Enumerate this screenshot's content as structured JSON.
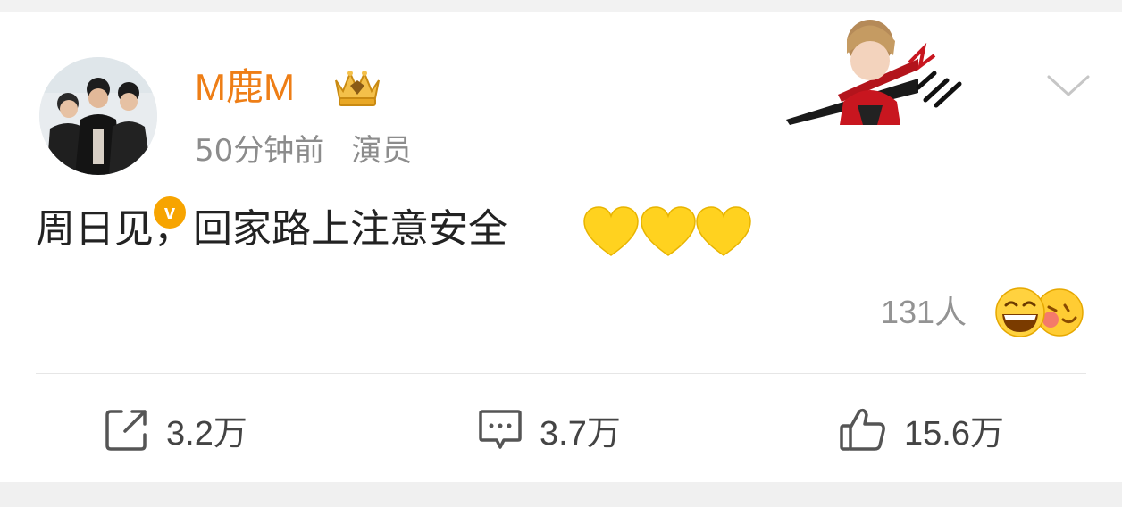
{
  "post": {
    "author": {
      "name": "M鹿M",
      "verified_mark": "v",
      "avatar": "avatar",
      "badge_icon": "crown-icon"
    },
    "time": "50分钟前",
    "source": "演员",
    "text": "周日见，回家路上注意安全",
    "emojis": [
      "yellow-heart",
      "yellow-heart",
      "yellow-heart"
    ]
  },
  "reactions": {
    "count": "131人",
    "icons": [
      "laughing-face",
      "hugging-face"
    ]
  },
  "actions": {
    "repost": {
      "icon": "repost-icon",
      "count": "3.2万"
    },
    "comment": {
      "icon": "comment-icon",
      "count": "3.7万"
    },
    "like": {
      "icon": "thumbs-up-icon",
      "count": "15.6万"
    }
  },
  "colors": {
    "username": "#ee7e16",
    "meta": "#8c8c8c",
    "text": "#222222",
    "verified": "#f7a400",
    "heart": "#ffd21f"
  }
}
